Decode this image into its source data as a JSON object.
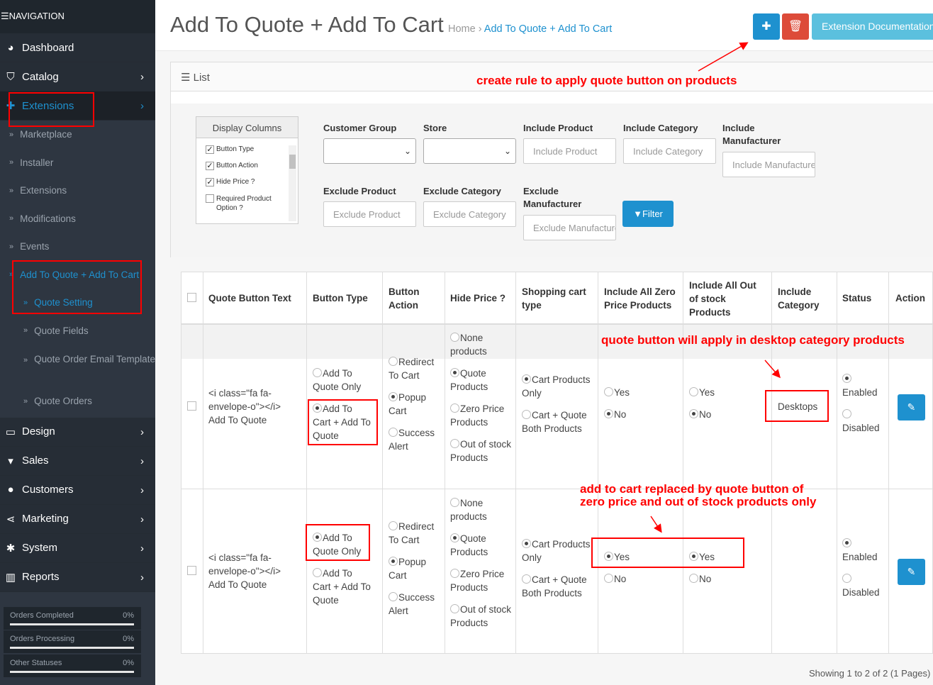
{
  "nav": {
    "header": "NAVIGATION",
    "items": [
      {
        "label": "Dashboard",
        "icon": "dashboard-icon"
      },
      {
        "label": "Catalog",
        "icon": "tags-icon"
      },
      {
        "label": "Extensions",
        "icon": "puzzle-icon"
      },
      {
        "label": "Design",
        "icon": "monitor-icon"
      },
      {
        "label": "Sales",
        "icon": "cart-icon"
      },
      {
        "label": "Customers",
        "icon": "user-icon"
      },
      {
        "label": "Marketing",
        "icon": "share-icon"
      },
      {
        "label": "System",
        "icon": "gear-icon"
      },
      {
        "label": "Reports",
        "icon": "bar-chart-icon"
      }
    ],
    "ext_sub": [
      "Marketplace",
      "Installer",
      "Extensions",
      "Modifications",
      "Events",
      "Add To Quote + Add To Cart"
    ],
    "quote_sub": [
      "Quote Setting",
      "Quote Fields",
      "Quote Order Email Template",
      "Quote Orders"
    ]
  },
  "stats": [
    {
      "label": "Orders Completed",
      "value": "0%"
    },
    {
      "label": "Orders Processing",
      "value": "0%"
    },
    {
      "label": "Other Statuses",
      "value": "0%"
    }
  ],
  "header": {
    "title": "Add To Quote + Add To Cart",
    "breadcrumb_home": "Home",
    "breadcrumb_sep": "›",
    "breadcrumb_current": "Add To Quote + Add To Cart",
    "doc_button": "Extension Documentation",
    "colors": {
      "add": "#1e91cf",
      "delete": "#dd4b39",
      "doc": "#5bc0de"
    }
  },
  "panel": {
    "title": "List"
  },
  "display_columns": {
    "title": "Display Columns",
    "items": [
      {
        "label": "Button Type",
        "checked": true
      },
      {
        "label": "Button Action",
        "checked": true
      },
      {
        "label": "Hide Price ?",
        "checked": true
      },
      {
        "label": "Required Product Option ?",
        "checked": false
      }
    ]
  },
  "filters": {
    "customer_group": "Customer Group",
    "store": "Store",
    "include_product": "Include Product",
    "include_category": "Include Category",
    "include_manufacturer": "Include Manufacturer",
    "exclude_product": "Exclude Product",
    "exclude_category": "Exclude Category",
    "exclude_manufacturer": "Exclude Manufacturer",
    "ph_include_product": "Include Product",
    "ph_include_category": "Include Category",
    "ph_include_manufacturer": "Include Manufacturer",
    "ph_exclude_product": "Exclude Product",
    "ph_exclude_category": "Exclude Category",
    "ph_exclude_manufacturer": "Exclude Manufacturer",
    "filter_button": "Filter"
  },
  "table": {
    "headers": [
      "Quote Button Text",
      "Button Type",
      "Button Action",
      "Hide Price ?",
      "Shopping cart type",
      "Include All Zero Price Products",
      "Include All Out of stock Products",
      "Include Category",
      "Status",
      "Action"
    ],
    "rows": [
      {
        "text": "<i class=\"fa fa-envelope-o\"></i> Add To Quote",
        "button_type": [
          {
            "label": "Add To Quote Only",
            "on": false
          },
          {
            "label": "Add To Cart + Add To Quote",
            "on": true
          }
        ],
        "button_action": [
          {
            "label": "Redirect To Cart",
            "on": false
          },
          {
            "label": "Popup Cart",
            "on": true
          },
          {
            "label": "Success Alert",
            "on": false
          }
        ],
        "hide_price": [
          {
            "label": "None products",
            "on": false
          },
          {
            "label": "Quote Products",
            "on": true
          },
          {
            "label": "Zero Price Products",
            "on": false
          },
          {
            "label": "Out of stock Products",
            "on": false
          }
        ],
        "cart_type": [
          {
            "label": "Cart Products Only",
            "on": true
          },
          {
            "label": "Cart + Quote Both Products",
            "on": false
          }
        ],
        "zero_price": [
          {
            "label": "Yes",
            "on": false
          },
          {
            "label": "No",
            "on": true
          }
        ],
        "out_of_stock": [
          {
            "label": "Yes",
            "on": false
          },
          {
            "label": "No",
            "on": true
          }
        ],
        "category": "Desktops",
        "status": [
          {
            "label": "Enabled",
            "on": true
          },
          {
            "label": "Disabled",
            "on": false
          }
        ]
      },
      {
        "text": "<i class=\"fa fa-envelope-o\"></i> Add To Quote",
        "button_type": [
          {
            "label": "Add To Quote Only",
            "on": true
          },
          {
            "label": "Add To Cart + Add To Quote",
            "on": false
          }
        ],
        "button_action": [
          {
            "label": "Redirect To Cart",
            "on": false
          },
          {
            "label": "Popup Cart",
            "on": true
          },
          {
            "label": "Success Alert",
            "on": false
          }
        ],
        "hide_price": [
          {
            "label": "None products",
            "on": false
          },
          {
            "label": "Quote Products",
            "on": true
          },
          {
            "label": "Zero Price Products",
            "on": false
          },
          {
            "label": "Out of stock Products",
            "on": false
          }
        ],
        "cart_type": [
          {
            "label": "Cart Products Only",
            "on": true
          },
          {
            "label": "Cart + Quote Both Products",
            "on": false
          }
        ],
        "zero_price": [
          {
            "label": "Yes",
            "on": true
          },
          {
            "label": "No",
            "on": false
          }
        ],
        "out_of_stock": [
          {
            "label": "Yes",
            "on": true
          },
          {
            "label": "No",
            "on": false
          }
        ],
        "category": "",
        "status": [
          {
            "label": "Enabled",
            "on": true
          },
          {
            "label": "Disabled",
            "on": false
          }
        ]
      }
    ]
  },
  "pagination": "Showing 1 to 2 of 2 (1 Pages)",
  "annotations": {
    "a1": "create rule to apply quote button on products",
    "a2": "quote button will apply in desktop category products",
    "a3_line1": "add to cart replaced by quote button of",
    "a3_line2": "zero price and out of stock products only",
    "color": "#ff0000"
  }
}
